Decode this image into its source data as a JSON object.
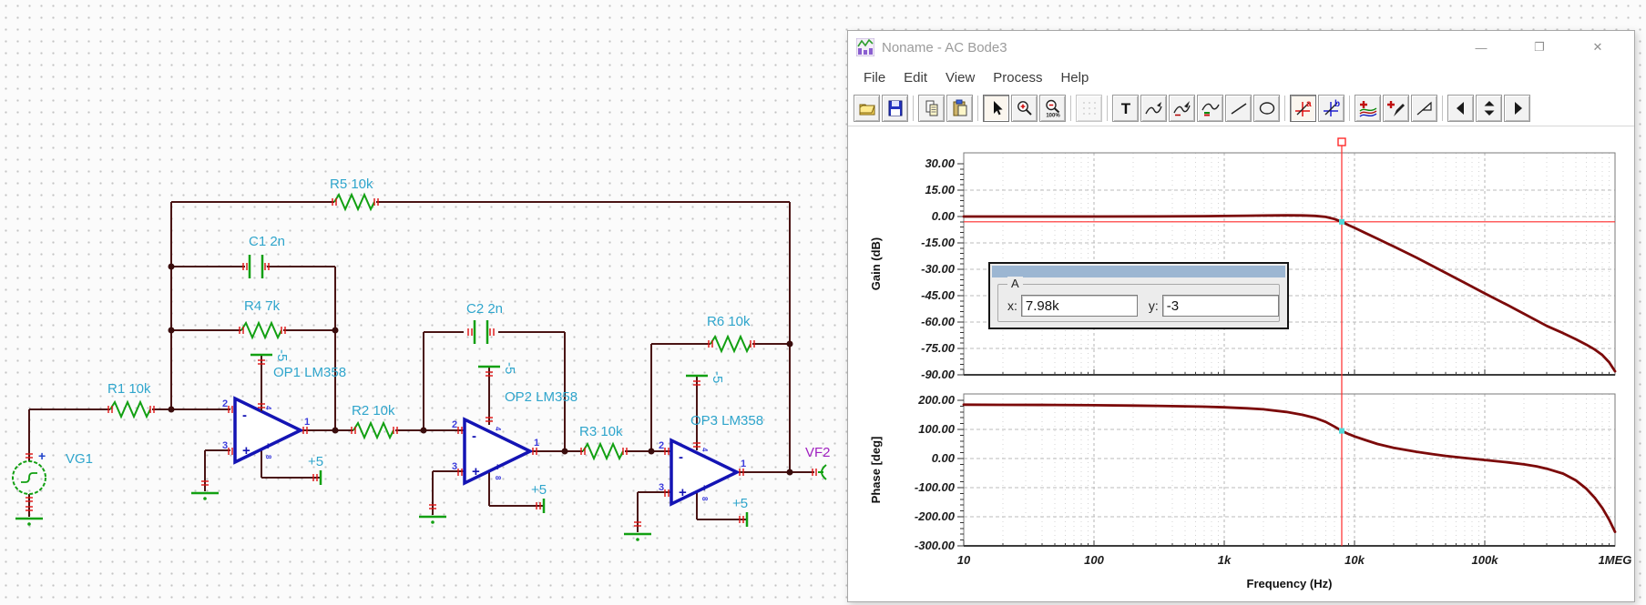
{
  "schematic": {
    "labels": {
      "r5": "R5 10k",
      "c1": "C1 2n",
      "r4": "R4 7k",
      "r1": "R1 10k",
      "vg1": "VG1",
      "op1": "OP1 LM358",
      "r2": "R2 10k",
      "c2": "C2 2n",
      "op2": "OP2 LM358",
      "r3": "R3 10k",
      "r6": "R6 10k",
      "op3": "OP3 LM358",
      "vf2": "VF2",
      "plus5": "+5",
      "minus5": "-5",
      "pin_inv": "2",
      "pin_noninv": "3",
      "pin_out": "1",
      "pin_vminus": "4",
      "pin_vplus": "8",
      "plus_sign": "+",
      "minus_sign": "-"
    },
    "colors": {
      "wire": "#4a1414",
      "component": "#12a012",
      "opamp": "#1414b4",
      "label": "#2fa5cc",
      "pin": "#3c3cdc",
      "terminal_label": "#a020c0",
      "mark": "#dd1111"
    }
  },
  "window": {
    "title": "Noname - AC Bode3",
    "controls": {
      "minimize": "—",
      "maximize": "❐",
      "close": "✕"
    },
    "menu": [
      "File",
      "Edit",
      "View",
      "Process",
      "Help"
    ],
    "toolbar": [
      {
        "name": "open-file-icon"
      },
      {
        "name": "save-icon"
      },
      {
        "sep": true
      },
      {
        "name": "copy-icon"
      },
      {
        "name": "paste-icon"
      },
      {
        "sep": true
      },
      {
        "name": "select-arrow-icon",
        "active": true
      },
      {
        "name": "zoom-in-icon"
      },
      {
        "name": "zoom-100-icon",
        "text": "100%"
      },
      {
        "sep": true
      },
      {
        "name": "grid-icon",
        "disabled": true
      },
      {
        "sep": true
      },
      {
        "name": "text-tool-icon",
        "text": "T"
      },
      {
        "name": "curve-edit-icon"
      },
      {
        "name": "curve-edit-alt-icon"
      },
      {
        "name": "curve-marks-icon"
      },
      {
        "name": "line-tool-icon"
      },
      {
        "name": "ellipse-tool-icon"
      },
      {
        "sep": true
      },
      {
        "name": "cursor-a-icon",
        "text": "a",
        "active": true
      },
      {
        "name": "cursor-b-icon",
        "text": "b"
      },
      {
        "sep": true
      },
      {
        "name": "add-curve-icon"
      },
      {
        "name": "pen-pick-icon"
      },
      {
        "name": "slope-flag-icon"
      },
      {
        "sep": true
      },
      {
        "name": "nav-left-icon"
      },
      {
        "name": "nav-spin-icon"
      },
      {
        "name": "nav-right-icon"
      }
    ]
  },
  "chart_data": {
    "type": "line",
    "x_scale": "log",
    "x_range": [
      10,
      1000000
    ],
    "x_label": "Frequency (Hz)",
    "x_ticks": [
      "10",
      "100",
      "1k",
      "10k",
      "100k",
      "1MEG"
    ],
    "grid": true,
    "panels": [
      {
        "name": "gain",
        "ylabel": "Gain (dB)",
        "ylim": [
          -90,
          30
        ],
        "yticks": [
          30,
          15,
          0,
          -15,
          -30,
          -45,
          -60,
          -75,
          -90
        ],
        "series": {
          "name": "gain",
          "color": "#7c0a0a",
          "x": [
            10,
            50,
            100,
            300,
            700,
            1000,
            1500,
            2000,
            3000,
            4000,
            5000,
            6000,
            7000,
            7980,
            9000,
            10000,
            12000,
            15000,
            20000,
            30000,
            50000,
            70000,
            100000,
            150000,
            200000,
            300000,
            400000,
            500000,
            600000,
            700000,
            800000,
            900000,
            1000000
          ],
          "y": [
            0,
            0,
            0,
            0.05,
            0.2,
            0.3,
            0.45,
            0.55,
            0.65,
            0.6,
            0.35,
            -0.2,
            -1.4,
            -3,
            -4.9,
            -6.4,
            -9.2,
            -12.6,
            -17,
            -23.4,
            -32,
            -37.6,
            -43.7,
            -50.4,
            -55.3,
            -62.2,
            -66.3,
            -69.8,
            -72.8,
            -75.6,
            -78.8,
            -82.8,
            -88
          ]
        }
      },
      {
        "name": "phase",
        "ylabel": "Phase [deg]",
        "ylim": [
          -300,
          200
        ],
        "yticks": [
          200,
          100,
          0,
          -100,
          -200,
          -300
        ],
        "series": {
          "name": "phase",
          "color": "#7c0a0a",
          "x": [
            10,
            20,
            50,
            100,
            200,
            300,
            500,
            700,
            1000,
            1500,
            2000,
            3000,
            4000,
            5000,
            6000,
            7000,
            7980,
            9000,
            10000,
            12000,
            15000,
            20000,
            30000,
            40000,
            50000,
            70000,
            100000,
            150000,
            200000,
            250000,
            300000,
            400000,
            500000,
            600000,
            700000,
            800000,
            900000,
            1000000
          ],
          "y": [
            185,
            184.5,
            184,
            183,
            182,
            181,
            179.5,
            178,
            176,
            172.5,
            169,
            160,
            150,
            139,
            126,
            110,
            95,
            84,
            76,
            64,
            50,
            37,
            23,
            15,
            9,
            2,
            -5,
            -13,
            -20,
            -27,
            -35,
            -52,
            -75,
            -103,
            -135,
            -170,
            -210,
            -252
          ]
        }
      }
    ],
    "cursor": {
      "group_label": "A",
      "x_label": "x:",
      "y_label": "y:",
      "x_value": "7.98k",
      "y_value": "-3",
      "x": 7980,
      "gain_y": -3,
      "phase_y": 95,
      "color": "#ff2a2a"
    }
  }
}
